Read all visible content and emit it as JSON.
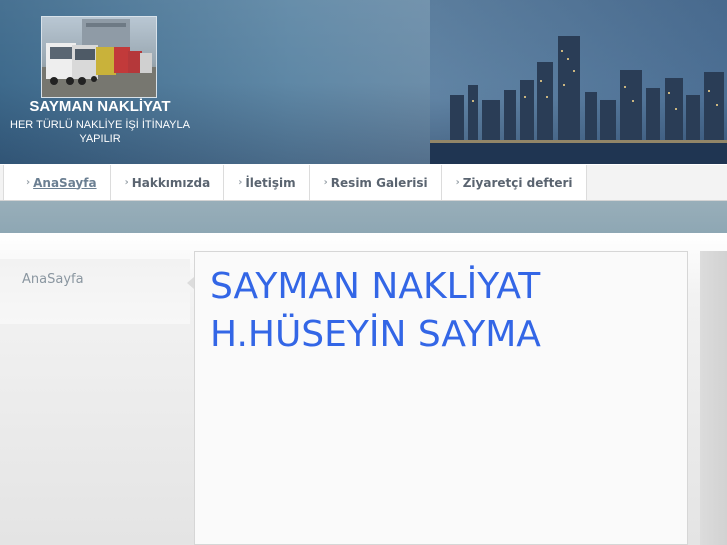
{
  "header": {
    "site_title": "SAYMAN NAKLİYAT",
    "slogan": "HER TÜRLÜ NAKLİYE İŞİ İTİNAYLA YAPILIR"
  },
  "nav": {
    "items": [
      {
        "label": "AnaSayfa",
        "active": true
      },
      {
        "label": "Hakkımızda",
        "active": false
      },
      {
        "label": "İletişim",
        "active": false
      },
      {
        "label": "Resim Galerisi",
        "active": false
      },
      {
        "label": "Ziyaretçi defteri",
        "active": false
      }
    ]
  },
  "sidebar": {
    "items": [
      {
        "label": "AnaSayfa"
      }
    ]
  },
  "content": {
    "lines": [
      "SAYMAN NAKLİYAT",
      "H.HÜSEYİN SAYMA"
    ]
  },
  "colors": {
    "accent": "#3366e6",
    "band": "#8ea7b4"
  },
  "icons": {
    "nav_chevron": "chevron-right-icon"
  }
}
